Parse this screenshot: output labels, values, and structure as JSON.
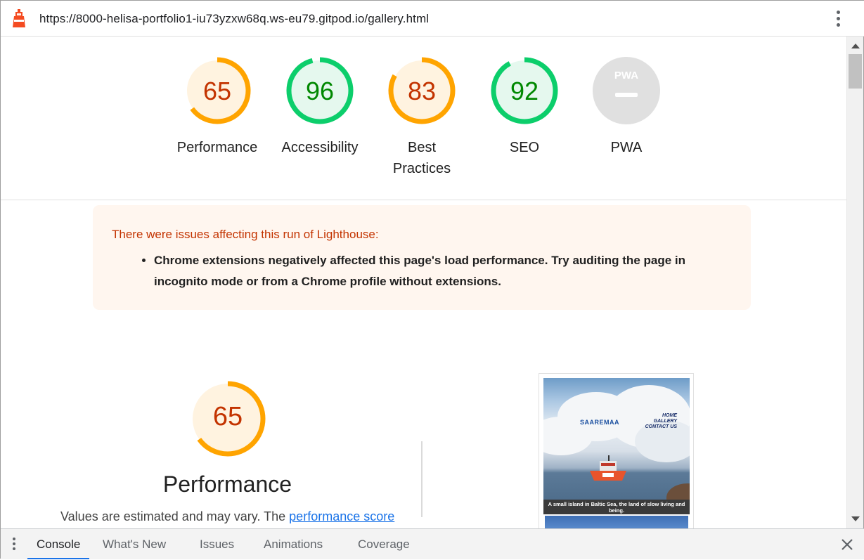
{
  "url": "https://8000-helisa-portfolio1-iu73yzxw68q.ws-eu79.gitpod.io/gallery.html",
  "gauges": [
    {
      "score": "65",
      "label": "Performance",
      "fraction": 0.65,
      "color": "#ffa400",
      "fill": "#fff3e0",
      "text": "#c33300"
    },
    {
      "score": "96",
      "label": "Accessibility",
      "fraction": 0.96,
      "color": "#0cce6b",
      "fill": "#e5f8ee",
      "text": "#008800"
    },
    {
      "score": "83",
      "label": "Best Practices",
      "fraction": 0.83,
      "color": "#ffa400",
      "fill": "#fff3e0",
      "text": "#c33300"
    },
    {
      "score": "92",
      "label": "SEO",
      "fraction": 0.92,
      "color": "#0cce6b",
      "fill": "#e5f8ee",
      "text": "#008800"
    },
    {
      "score": "PWA",
      "label": "PWA",
      "fraction": 0,
      "color": "#cccccc",
      "fill": "#e0e0e0",
      "text": "#ffffff"
    }
  ],
  "warning": {
    "title": "There were issues affecting this run of Lighthouse:",
    "item": "Chrome extensions negatively affected this page's load performance. Try auditing the page in incognito mode or from a Chrome profile without extensions."
  },
  "performance": {
    "score": "65",
    "fraction": 0.65,
    "title": "Performance",
    "desc_prefix": "Values are estimated and may vary. The ",
    "desc_link": "performance score"
  },
  "screenshot": {
    "brand": "SAAREMAA",
    "nav": [
      "HOME",
      "GALLERY",
      "CONTACT US"
    ],
    "caption": "A small island in Baltic Sea, the land of slow living and being."
  },
  "drawer": {
    "tabs": [
      "Console",
      "What's New",
      "Issues",
      "Animations",
      "Coverage"
    ],
    "active": "Console"
  },
  "colors": {
    "accent": "#1a73e8",
    "warning_text": "#c33300",
    "warning_bg": "#fff6ef"
  }
}
